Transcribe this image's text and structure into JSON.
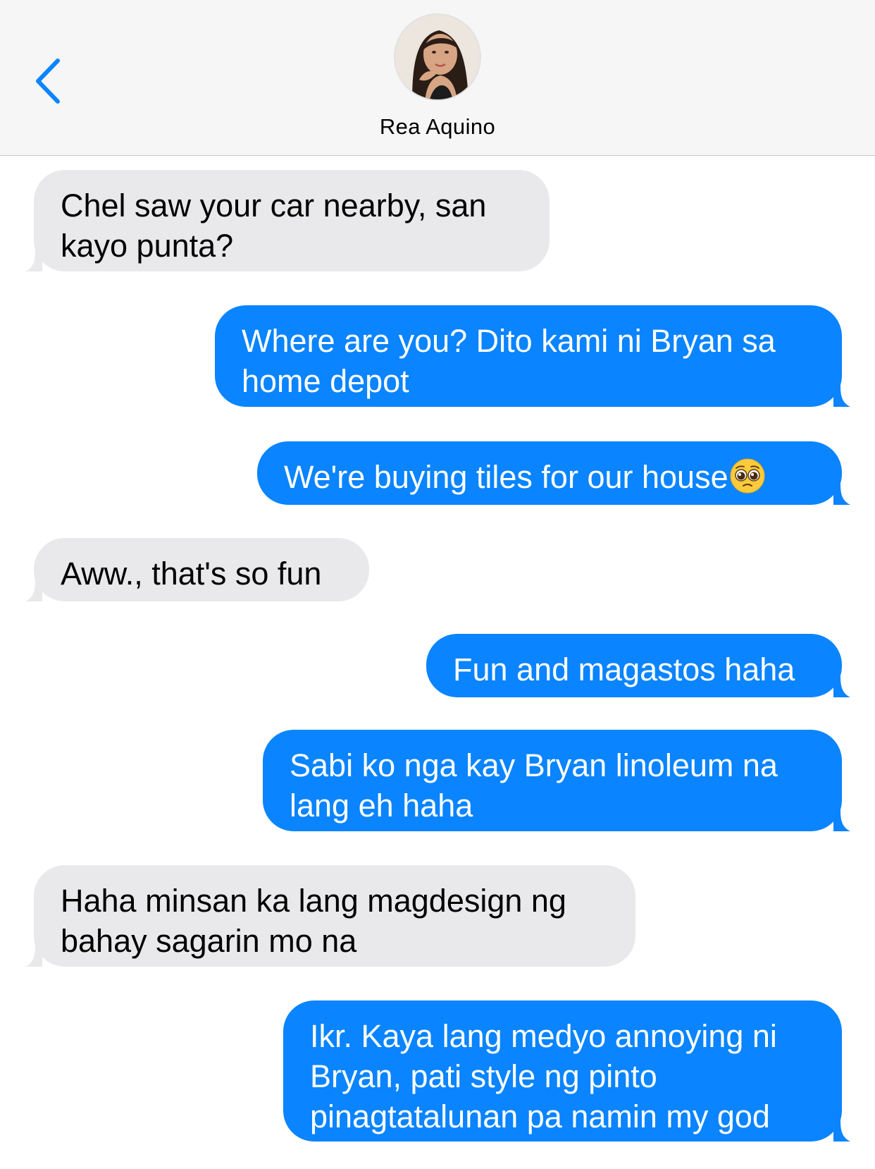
{
  "header": {
    "contact_name": "Rea Aquino",
    "back_icon": "chevron-left-icon",
    "avatar": "contact-photo"
  },
  "colors": {
    "incoming_bubble": "#e9e9eb",
    "outgoing_bubble": "#0a84ff",
    "accent": "#0a84ff",
    "header_bg": "#f6f6f6"
  },
  "messages": [
    {
      "direction": "incoming",
      "lines": [
        "Chel saw your car nearby, san",
        "kayo punta?"
      ]
    },
    {
      "direction": "outgoing",
      "lines": [
        "Where are you? Dito kami ni Bryan sa",
        "home depot"
      ]
    },
    {
      "direction": "outgoing",
      "lines": [
        "We're buying tiles for our house"
      ],
      "emoji": "pleading-face-emoji"
    },
    {
      "direction": "incoming",
      "lines": [
        "Aww., that's so fun"
      ]
    },
    {
      "direction": "outgoing",
      "lines": [
        "Fun and magastos haha"
      ]
    },
    {
      "direction": "outgoing",
      "lines": [
        "Sabi ko nga kay Bryan linoleum na",
        "lang eh haha"
      ]
    },
    {
      "direction": "incoming",
      "lines": [
        "Haha minsan ka lang magdesign ng",
        "bahay sagarin mo na"
      ]
    },
    {
      "direction": "outgoing",
      "lines": [
        "Ikr. Kaya lang medyo annoying ni",
        "Bryan, pati style ng pinto",
        "pinagtatalunan pa namin my god"
      ]
    }
  ]
}
